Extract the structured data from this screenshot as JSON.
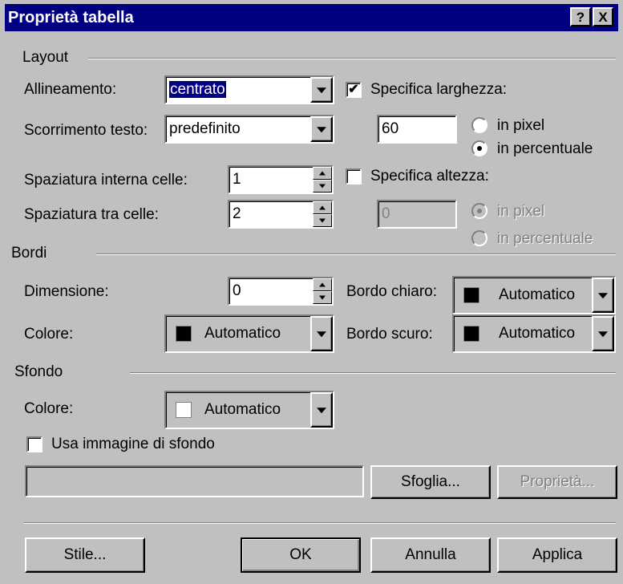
{
  "window": {
    "title": "Proprietà tabella",
    "help_label": "?",
    "close_label": "X"
  },
  "layout": {
    "group_label": "Layout",
    "allineamento_label": "Allineamento:",
    "allineamento_value": "centrato",
    "scorrimento_label": "Scorrimento testo:",
    "scorrimento_value": "predefinito",
    "spaz_interna_label": "Spaziatura interna celle:",
    "spaz_interna_value": "1",
    "spaz_tra_label": "Spaziatura tra celle:",
    "spaz_tra_value": "2",
    "larghezza_checked": true,
    "larghezza_label": "Specifica larghezza:",
    "larghezza_value": "60",
    "larghezza_px_label": "in pixel",
    "larghezza_pct_label": "in percentuale",
    "larghezza_unit_selected": "in percentuale",
    "altezza_checked": false,
    "altezza_label": "Specifica altezza:",
    "altezza_value": "0",
    "altezza_px_label": "in pixel",
    "altezza_pct_label": "in percentuale",
    "altezza_unit_selected": "in pixel"
  },
  "bordi": {
    "group_label": "Bordi",
    "dimensione_label": "Dimensione:",
    "dimensione_value": "0",
    "colore_label": "Colore:",
    "colore_value": "Automatico",
    "colore_swatch": "#000000",
    "chiaro_label": "Bordo chiaro:",
    "chiaro_value": "Automatico",
    "chiaro_swatch": "#000000",
    "scuro_label": "Bordo scuro:",
    "scuro_value": "Automatico",
    "scuro_swatch": "#000000"
  },
  "sfondo": {
    "group_label": "Sfondo",
    "colore_label": "Colore:",
    "colore_value": "Automatico",
    "colore_swatch": "#ffffff",
    "usa_immagine_checked": false,
    "usa_immagine_label": "Usa immagine di sfondo",
    "image_path": "",
    "sfoglia_label": "Sfoglia...",
    "proprieta_label": "Proprietà..."
  },
  "footer": {
    "stile_label": "Stile...",
    "ok_label": "OK",
    "annulla_label": "Annulla",
    "applica_label": "Applica"
  },
  "colors": {
    "titlebar": "#000080",
    "face": "#c0c0c0"
  }
}
